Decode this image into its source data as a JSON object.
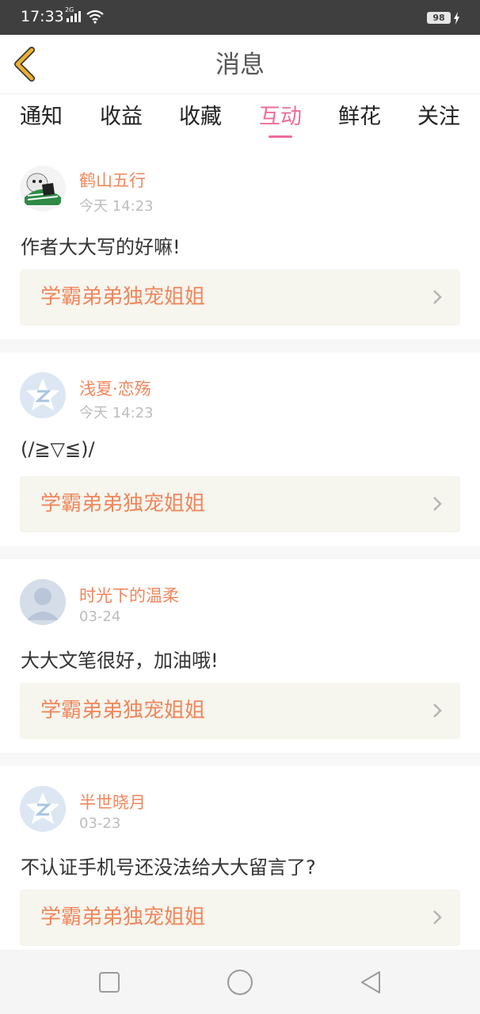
{
  "status_bar": {
    "time": "17:33",
    "network": "2G",
    "battery": "98"
  },
  "header": {
    "title": "消息",
    "back_icon": "chevron-left-icon",
    "accent_color": "#f0b030"
  },
  "tabs": [
    {
      "label": "通知",
      "active": false
    },
    {
      "label": "收益",
      "active": false
    },
    {
      "label": "收藏",
      "active": false
    },
    {
      "label": "互动",
      "active": true
    },
    {
      "label": "鲜花",
      "active": false
    },
    {
      "label": "关注",
      "active": false
    }
  ],
  "colors": {
    "active_tab": "#ef6c9c",
    "username": "#f0875c",
    "book_bg": "#f6f5ee"
  },
  "messages": [
    {
      "username": "鹤山五行",
      "time": "今天 14:23",
      "content": "作者大大写的好嘛!",
      "book_title": "学霸弟弟独宠姐姐",
      "avatar": "cartoon-avatar"
    },
    {
      "username": "浅夏·恋殇",
      "time": "今天 14:23",
      "content": "(/≧▽≦)/",
      "book_title": "学霸弟弟独宠姐姐",
      "avatar": "qzone-star-avatar"
    },
    {
      "username": "时光下的温柔",
      "time": "03-24",
      "content": "大大文笔很好，加油哦!",
      "book_title": "学霸弟弟独宠姐姐",
      "avatar": "default-person-avatar"
    },
    {
      "username": "半世晓月",
      "time": "03-23",
      "content": "不认证手机号还没法给大大留言了?",
      "book_title": "学霸弟弟独宠姐姐",
      "avatar": "qzone-star-avatar"
    }
  ],
  "nav_bar": {
    "icons": [
      "square-icon",
      "circle-icon",
      "triangle-back-icon"
    ]
  }
}
